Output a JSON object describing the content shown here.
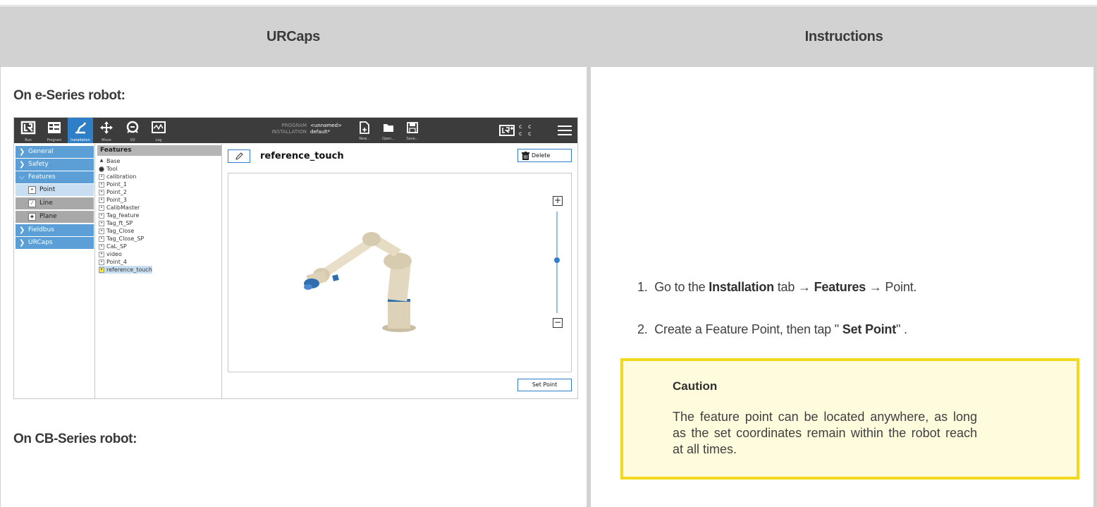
{
  "headers": {
    "left": "URCaps",
    "right": "Instructions"
  },
  "left": {
    "e_series_heading": "On e-Series robot:",
    "cb_series_heading": "On CB-Series robot:"
  },
  "robot_ui": {
    "nav": [
      {
        "label": "Run",
        "icon": "ur-logo-icon"
      },
      {
        "label": "Program",
        "icon": "program-icon"
      },
      {
        "label": "Installation",
        "icon": "installation-icon",
        "active": true
      },
      {
        "label": "Move",
        "icon": "move-arrows-icon"
      },
      {
        "label": "I/O",
        "icon": "io-icon"
      },
      {
        "label": "Log",
        "icon": "log-icon"
      }
    ],
    "program_label": "PROGRAM",
    "installation_label": "INSTALLATION",
    "program_value": "<unnamed>",
    "installation_value": "default*",
    "file_buttons": [
      {
        "label": "New...",
        "icon": "new-file-icon"
      },
      {
        "label": "Open...",
        "icon": "folder-icon"
      },
      {
        "label": "Save...",
        "icon": "save-icon"
      }
    ],
    "cc_text": "c c\nc c",
    "sidebar": {
      "general": "General",
      "safety": "Safety",
      "features": "Features",
      "point": "Point",
      "line": "Line",
      "plane": "Plane",
      "fieldbus": "Fieldbus",
      "urcaps": "URCaps"
    },
    "features_title": "Features",
    "features": [
      "Base",
      "Tool",
      "calibration",
      "Point_1",
      "Point_2",
      "Point_3",
      "CalibMaster",
      "Tag_feature",
      "Tag_ft_SP",
      "Tag_Close",
      "Tag_Close_SP",
      "CaL_SP",
      "video",
      "Point_4",
      "reference_touch"
    ],
    "selected_feature": "reference_touch",
    "detail_title": "reference_touch",
    "delete_label": "Delete",
    "set_point_label": "Set Point",
    "zoom_plus": "+",
    "zoom_minus": "−"
  },
  "instructions": {
    "step1": {
      "num": "1.",
      "pre": "Go to the ",
      "b1": "Installation",
      "mid1": " tab → ",
      "b2": "Features",
      "mid2": " → Point."
    },
    "step2": {
      "num": "2.",
      "pre": "Create a Feature Point, then tap \" ",
      "b1": "Set Point",
      "post": "\" ."
    },
    "caution_title": "Caution",
    "caution_body": "The feature point can be located anywhere, as long as the set coordinates remain within the robot reach at all times."
  },
  "colors": {
    "header_bg": "#d2d2d2",
    "caution_border": "#f2d91e",
    "caution_bg": "#fffbdc",
    "ur_blue": "#2f7ec8",
    "sidebar_blue": "#5b9fd6"
  }
}
